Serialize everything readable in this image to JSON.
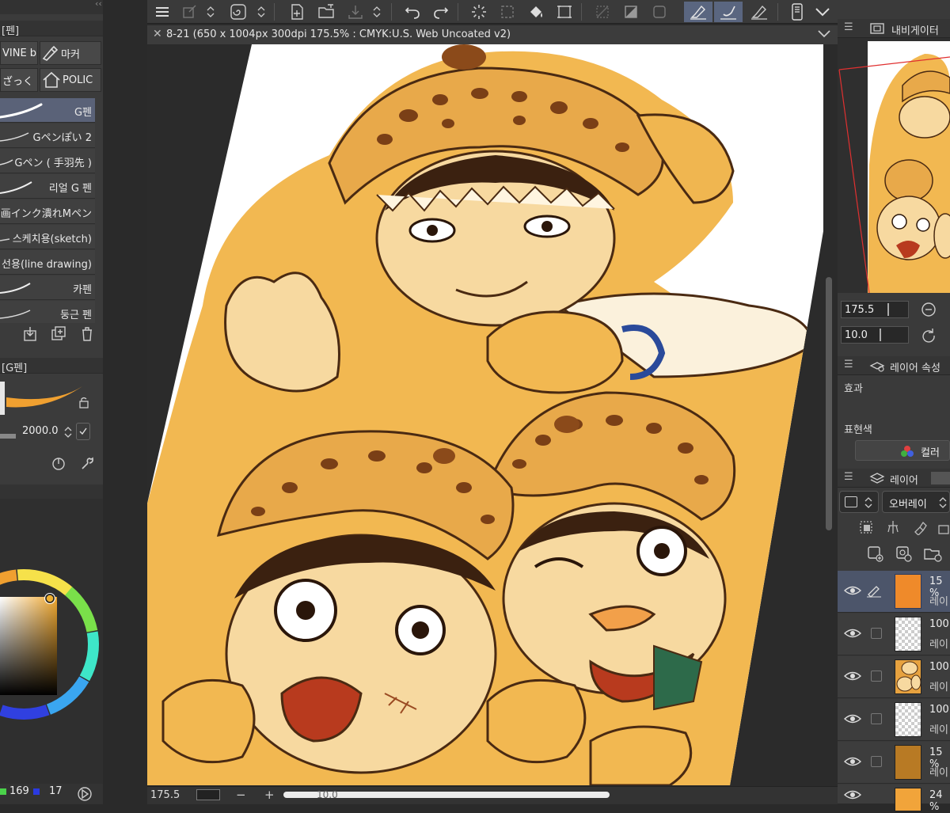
{
  "document": {
    "tab_title": "8-21 (650 x 1004px 300dpi 175.5% : CMYK:U.S. Web Uncoated v2)"
  },
  "left_panel": {
    "header_label": "[펜]",
    "subtabs": [
      "VINE b",
      "마커",
      "ざっく",
      "POLIC"
    ],
    "brushes": [
      {
        "name": "G펜",
        "selected": true
      },
      {
        "name": "Gペンぽい 2",
        "selected": false
      },
      {
        "name": "Gペン ( 手羽先 )",
        "selected": false
      },
      {
        "name": "리얼 G 펜",
        "selected": false
      },
      {
        "name": "画インク潰れMペン",
        "selected": false
      },
      {
        "name": "스케치용(sketch)",
        "selected": false
      },
      {
        "name": "선용(line drawing)",
        "selected": false
      },
      {
        "name": "카펜",
        "selected": false
      },
      {
        "name": "둥근 펜",
        "selected": false
      }
    ],
    "tool_property_label": "[G펜]",
    "brush_size": "2000.0",
    "color_values": {
      "g": "169",
      "b": "17"
    }
  },
  "bottom_bar": {
    "zoom": "175.5",
    "rotation": "10.0"
  },
  "navigator": {
    "title": "내비게이터",
    "zoom": "175.5",
    "rotation": "10.0"
  },
  "layer_property": {
    "title": "레이어 속성",
    "effect_label": "효과",
    "expression_color_label": "표현색",
    "color_button": "컬러"
  },
  "layers_panel": {
    "title": "레이어",
    "blend_mode": "오버레이",
    "layers": [
      {
        "opacity": "15 %",
        "name": "레이",
        "thumb": "orange",
        "selected": true,
        "pen": true
      },
      {
        "opacity": "100",
        "name": "레이",
        "thumb": "checker",
        "selected": false,
        "pen": false
      },
      {
        "opacity": "100",
        "name": "레이",
        "thumb": "art",
        "selected": false,
        "pen": false
      },
      {
        "opacity": "100",
        "name": "레이",
        "thumb": "checker",
        "selected": false,
        "pen": false
      },
      {
        "opacity": "15 %",
        "name": "레이",
        "thumb": "brown",
        "selected": false,
        "pen": false
      },
      {
        "opacity": "24 %",
        "name": "",
        "thumb": "yellow",
        "selected": false,
        "pen": false
      }
    ]
  },
  "colors": {
    "accent_selection": "#5a6278",
    "layer_orange": "#ef8a2a",
    "layer_brown": "#b87a24",
    "layer_yellow": "#f1a43a"
  }
}
